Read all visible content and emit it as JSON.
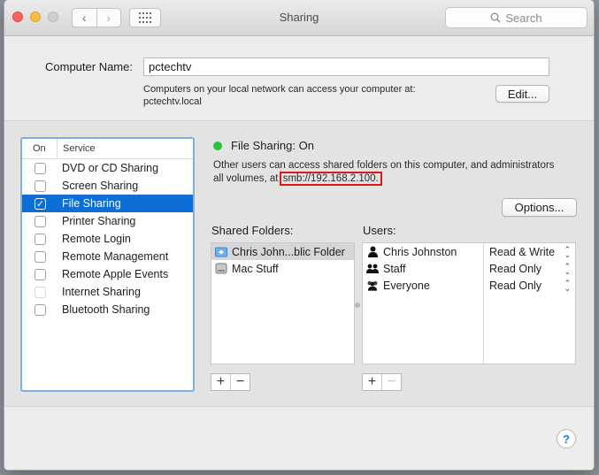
{
  "window": {
    "title": "Sharing"
  },
  "toolbar": {
    "back": "‹",
    "forward": "›",
    "search_placeholder": "Search"
  },
  "computer_name": {
    "label": "Computer Name:",
    "value": "pctechtv",
    "desc_line1": "Computers on your local network can access your computer at:",
    "desc_line2": "pctechtv.local",
    "edit_label": "Edit..."
  },
  "services": {
    "header_on": "On",
    "header_service": "Service",
    "items": [
      {
        "label": "DVD or CD Sharing",
        "checked": false,
        "dim": false
      },
      {
        "label": "Screen Sharing",
        "checked": false,
        "dim": false
      },
      {
        "label": "File Sharing",
        "checked": true,
        "selected": true,
        "dim": false
      },
      {
        "label": "Printer Sharing",
        "checked": false,
        "dim": false
      },
      {
        "label": "Remote Login",
        "checked": false,
        "dim": false
      },
      {
        "label": "Remote Management",
        "checked": false,
        "dim": false
      },
      {
        "label": "Remote Apple Events",
        "checked": false,
        "dim": false
      },
      {
        "label": "Internet Sharing",
        "checked": false,
        "dim": true
      },
      {
        "label": "Bluetooth Sharing",
        "checked": false,
        "dim": false
      }
    ]
  },
  "detail": {
    "status": "File Sharing: On",
    "status_color": "#29c23f",
    "desc_line1": "Other users can access shared folders on this computer, and administrators",
    "desc_line2_prefix": "all volumes, at",
    "smb_address": "smb://192.168.2.100.",
    "options_label": "Options...",
    "shared_folders_label": "Shared Folders:",
    "users_label": "Users:",
    "folders": [
      {
        "name": "Chris John...blic Folder",
        "icon": "shared-folder-icon",
        "selected": true
      },
      {
        "name": "Mac Stuff",
        "icon": "disk-icon",
        "selected": false
      }
    ],
    "users": [
      {
        "name": "Chris Johnston",
        "icon": "user-icon",
        "permission": "Read & Write"
      },
      {
        "name": "Staff",
        "icon": "group-icon",
        "permission": "Read Only"
      },
      {
        "name": "Everyone",
        "icon": "everyone-icon",
        "permission": "Read Only"
      }
    ],
    "add_symbol": "+",
    "remove_symbol": "−"
  },
  "help": {
    "label": "?"
  }
}
